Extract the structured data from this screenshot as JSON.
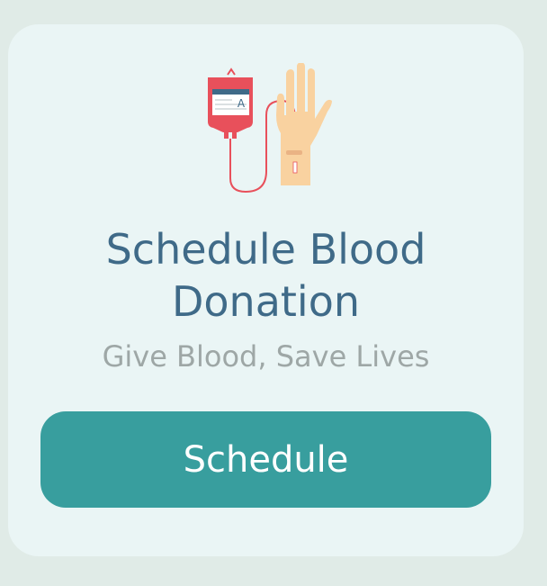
{
  "card": {
    "illustration": {
      "icon": "blood-donation-icon",
      "bag_label": "A"
    },
    "title": "Schedule Blood Donation",
    "subtitle": "Give Blood, Save Lives",
    "button_label": "Schedule"
  },
  "colors": {
    "background": "#e0ebe7",
    "card": "#eaf5f5",
    "title": "#3f6a88",
    "subtitle": "#9ea7a6",
    "button": "#389e9e",
    "button_text": "#ffffff",
    "blood": "#e8505b",
    "skin": "#f9d2a0"
  }
}
